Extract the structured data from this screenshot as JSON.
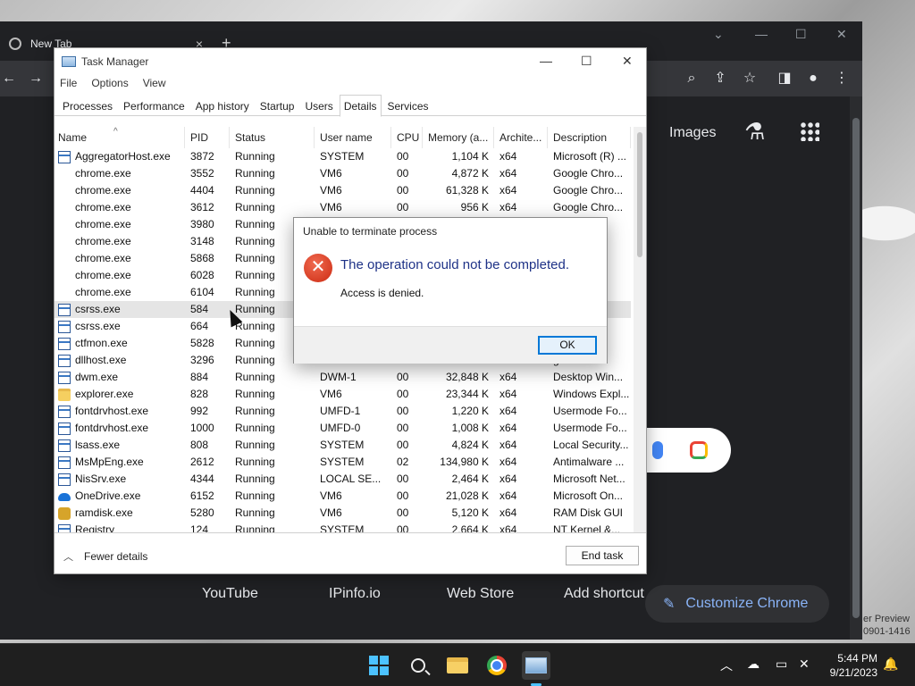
{
  "chrome": {
    "tab_title": "New Tab",
    "tab_close": "×",
    "new_tab": "+",
    "top_links": {
      "gmail_partial": "il",
      "images": "Images"
    },
    "shortcuts": [
      "YouTube",
      "IPinfo.io",
      "Web Store",
      "Add shortcut"
    ],
    "customize": "Customize Chrome",
    "preview_note": [
      "er Preview",
      "0901-1416"
    ]
  },
  "task_manager": {
    "title": "Task Manager",
    "menu": [
      "File",
      "Options",
      "View"
    ],
    "tabs": [
      "Processes",
      "Performance",
      "App history",
      "Startup",
      "Users",
      "Details",
      "Services"
    ],
    "active_tab": "Details",
    "columns": [
      "Name",
      "PID",
      "Status",
      "User name",
      "CPU",
      "Memory (a...",
      "Archite...",
      "Description"
    ],
    "rows": [
      {
        "icon": "exe",
        "name": "AggregatorHost.exe",
        "pid": "3872",
        "status": "Running",
        "user": "SYSTEM",
        "cpu": "00",
        "mem": "1,104 K",
        "arch": "x64",
        "desc": "Microsoft (R) ..."
      },
      {
        "icon": "chrome",
        "name": "chrome.exe",
        "pid": "3552",
        "status": "Running",
        "user": "VM6",
        "cpu": "00",
        "mem": "4,872 K",
        "arch": "x64",
        "desc": "Google Chro..."
      },
      {
        "icon": "chrome",
        "name": "chrome.exe",
        "pid": "4404",
        "status": "Running",
        "user": "VM6",
        "cpu": "00",
        "mem": "61,328 K",
        "arch": "x64",
        "desc": "Google Chro..."
      },
      {
        "icon": "chrome",
        "name": "chrome.exe",
        "pid": "3612",
        "status": "Running",
        "user": "VM6",
        "cpu": "00",
        "mem": "956 K",
        "arch": "x64",
        "desc": "Google Chro..."
      },
      {
        "icon": "chrome",
        "name": "chrome.exe",
        "pid": "3980",
        "status": "Running",
        "user": "",
        "cpu": "",
        "mem": "",
        "arch": "",
        "desc": "o..."
      },
      {
        "icon": "chrome",
        "name": "chrome.exe",
        "pid": "3148",
        "status": "Running",
        "user": "",
        "cpu": "",
        "mem": "",
        "arch": "",
        "desc": "o..."
      },
      {
        "icon": "chrome",
        "name": "chrome.exe",
        "pid": "5868",
        "status": "Running",
        "user": "",
        "cpu": "",
        "mem": "",
        "arch": "",
        "desc": "o..."
      },
      {
        "icon": "chrome",
        "name": "chrome.exe",
        "pid": "6028",
        "status": "Running",
        "user": "",
        "cpu": "",
        "mem": "",
        "arch": "",
        "desc": "o..."
      },
      {
        "icon": "chrome",
        "name": "chrome.exe",
        "pid": "6104",
        "status": "Running",
        "user": "",
        "cpu": "",
        "mem": "",
        "arch": "",
        "desc": "o..."
      },
      {
        "icon": "exe",
        "name": "csrss.exe",
        "pid": "584",
        "status": "Running",
        "user": "",
        "cpu": "",
        "mem": "",
        "arch": "",
        "desc": "r ...",
        "selected": true
      },
      {
        "icon": "exe",
        "name": "csrss.exe",
        "pid": "664",
        "status": "Running",
        "user": "",
        "cpu": "",
        "mem": "",
        "arch": "",
        "desc": "r ..."
      },
      {
        "icon": "exe",
        "name": "ctfmon.exe",
        "pid": "5828",
        "status": "Running",
        "user": "",
        "cpu": "",
        "mem": "",
        "arch": "",
        "desc": ""
      },
      {
        "icon": "exe",
        "name": "dllhost.exe",
        "pid": "3296",
        "status": "Running",
        "user": "",
        "cpu": "",
        "mem": "",
        "arch": "",
        "desc": "gate"
      },
      {
        "icon": "exe",
        "name": "dwm.exe",
        "pid": "884",
        "status": "Running",
        "user": "DWM-1",
        "cpu": "00",
        "mem": "32,848 K",
        "arch": "x64",
        "desc": "Desktop Win..."
      },
      {
        "icon": "folder",
        "name": "explorer.exe",
        "pid": "828",
        "status": "Running",
        "user": "VM6",
        "cpu": "00",
        "mem": "23,344 K",
        "arch": "x64",
        "desc": "Windows Expl..."
      },
      {
        "icon": "exe",
        "name": "fontdrvhost.exe",
        "pid": "992",
        "status": "Running",
        "user": "UMFD-1",
        "cpu": "00",
        "mem": "1,220 K",
        "arch": "x64",
        "desc": "Usermode Fo..."
      },
      {
        "icon": "exe",
        "name": "fontdrvhost.exe",
        "pid": "1000",
        "status": "Running",
        "user": "UMFD-0",
        "cpu": "00",
        "mem": "1,008 K",
        "arch": "x64",
        "desc": "Usermode Fo..."
      },
      {
        "icon": "exe",
        "name": "lsass.exe",
        "pid": "808",
        "status": "Running",
        "user": "SYSTEM",
        "cpu": "00",
        "mem": "4,824 K",
        "arch": "x64",
        "desc": "Local Security..."
      },
      {
        "icon": "exe",
        "name": "MsMpEng.exe",
        "pid": "2612",
        "status": "Running",
        "user": "SYSTEM",
        "cpu": "02",
        "mem": "134,980 K",
        "arch": "x64",
        "desc": "Antimalware ..."
      },
      {
        "icon": "exe",
        "name": "NisSrv.exe",
        "pid": "4344",
        "status": "Running",
        "user": "LOCAL SE...",
        "cpu": "00",
        "mem": "2,464 K",
        "arch": "x64",
        "desc": "Microsoft Net..."
      },
      {
        "icon": "onedrive",
        "name": "OneDrive.exe",
        "pid": "6152",
        "status": "Running",
        "user": "VM6",
        "cpu": "00",
        "mem": "21,028 K",
        "arch": "x64",
        "desc": "Microsoft On..."
      },
      {
        "icon": "ram",
        "name": "ramdisk.exe",
        "pid": "5280",
        "status": "Running",
        "user": "VM6",
        "cpu": "00",
        "mem": "5,120 K",
        "arch": "x64",
        "desc": "RAM Disk GUI"
      },
      {
        "icon": "exe",
        "name": "Registry",
        "pid": "124",
        "status": "Running",
        "user": "SYSTEM",
        "cpu": "00",
        "mem": "2,664 K",
        "arch": "x64",
        "desc": "NT Kernel &..."
      }
    ],
    "fewer_details": "Fewer details",
    "end_task": "End task"
  },
  "dialog": {
    "title": "Unable to terminate process",
    "message": "The operation could not be completed.",
    "detail": "Access is denied.",
    "ok": "OK"
  },
  "taskbar": {
    "time": "5:44 PM",
    "date": "9/21/2023"
  }
}
